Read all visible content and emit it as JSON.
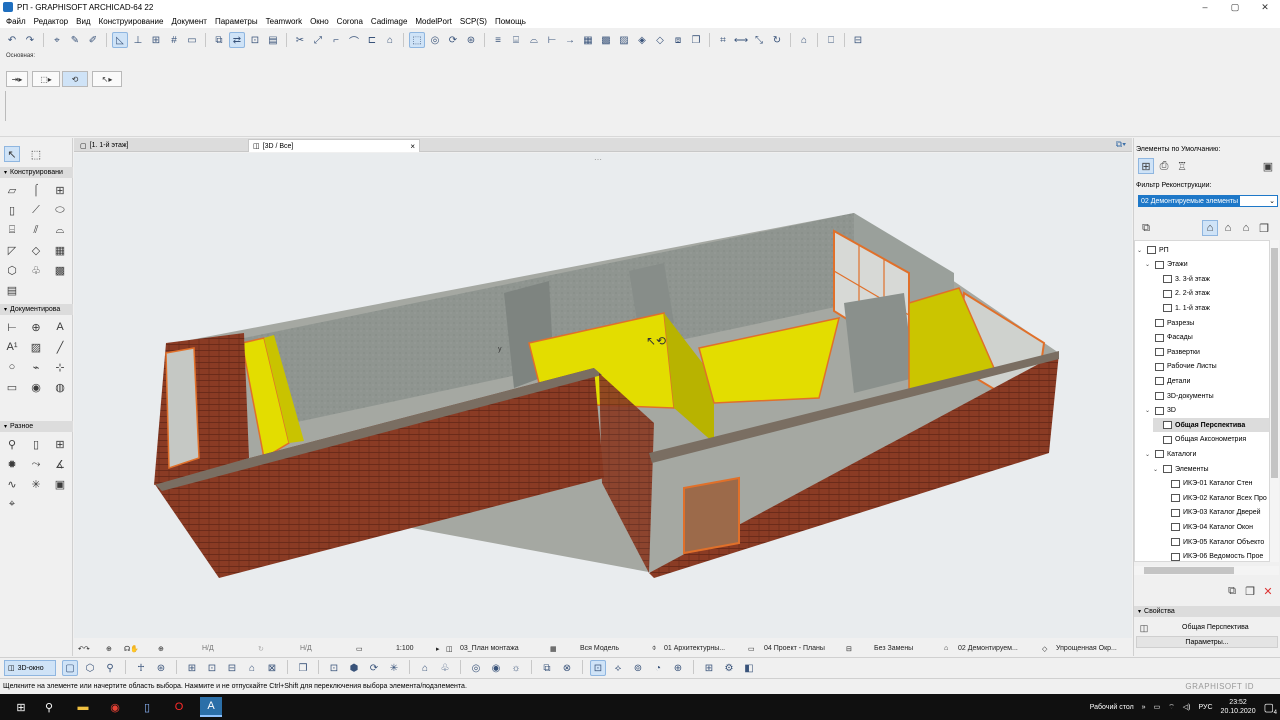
{
  "window": {
    "title": "РП - GRAPHISOFT ARCHICAD-64 22",
    "controls": [
      "‒",
      "▢",
      "✕"
    ]
  },
  "menu": [
    "Файл",
    "Редактор",
    "Вид",
    "Конструирование",
    "Документ",
    "Параметры",
    "Teamwork",
    "Окно",
    "Corona",
    "Cadimage",
    "ModelPort",
    "SCP(S)",
    "Помощь"
  ],
  "infobox": {
    "label": "Основная:"
  },
  "toolbox": {
    "sections": [
      "Конструировани",
      "Документирова",
      "Разное"
    ]
  },
  "tabs": [
    {
      "label": "[1. 1-й этаж]"
    },
    {
      "label": "[3D / Все]",
      "close": "×"
    }
  ],
  "navigator": {
    "header": "Элементы по Умолчанию:",
    "filter_label": "Фильтр Реконструкции:",
    "filter_value": "02 Демонтируемые элементы",
    "tree": [
      {
        "label": "РП",
        "level": 0,
        "toggle": "⌄"
      },
      {
        "label": "Этажи",
        "level": 1,
        "toggle": "⌄"
      },
      {
        "label": "3. 3-й этаж",
        "level": 2,
        "toggle": ""
      },
      {
        "label": "2. 2-й этаж",
        "level": 2,
        "toggle": ""
      },
      {
        "label": "1. 1-й этаж",
        "level": 2,
        "toggle": ""
      },
      {
        "label": "Разрезы",
        "level": 1,
        "toggle": ""
      },
      {
        "label": "Фасады",
        "level": 1,
        "toggle": ""
      },
      {
        "label": "Развертки",
        "level": 1,
        "toggle": ""
      },
      {
        "label": "Рабочие Листы",
        "level": 1,
        "toggle": ""
      },
      {
        "label": "Детали",
        "level": 1,
        "toggle": ""
      },
      {
        "label": "3D-документы",
        "level": 1,
        "toggle": ""
      },
      {
        "label": "3D",
        "level": 1,
        "toggle": "⌄"
      },
      {
        "label": "Общая Перспектива",
        "level": 2,
        "toggle": "",
        "selected": true
      },
      {
        "label": "Общая Аксонометрия",
        "level": 2,
        "toggle": ""
      },
      {
        "label": "Каталоги",
        "level": 1,
        "toggle": "⌄"
      },
      {
        "label": "Элементы",
        "level": 2,
        "toggle": "⌄"
      },
      {
        "label": "ИКЭ-01 Каталог Стен",
        "level": 3,
        "toggle": ""
      },
      {
        "label": "ИКЭ-02 Каталог Всех Про",
        "level": 3,
        "toggle": ""
      },
      {
        "label": "ИКЭ-03 Каталог Дверей",
        "level": 3,
        "toggle": ""
      },
      {
        "label": "ИКЭ-04 Каталог Окон",
        "level": 3,
        "toggle": ""
      },
      {
        "label": "ИКЭ-05 Каталог Объекто",
        "level": 3,
        "toggle": ""
      },
      {
        "label": "ИКЭ-06 Ведомость Прое",
        "level": 3,
        "toggle": ""
      }
    ],
    "properties_header": "Свойства",
    "properties_value": "Общая Перспектива",
    "params_button": "Параметры..."
  },
  "quick_options": {
    "scale1": "Н/Д",
    "scale2": "Н/Д",
    "scale": "1:100",
    "layer_combo": "03_План монтажа",
    "model_view": "Вся Модель",
    "pen_set": "01 Архитектурны...",
    "dimension": "04 Проект - Планы",
    "override": "Без Замены",
    "renovation": "02 Демонтируем...",
    "structure": "Упрощенная Окр..."
  },
  "bottom": {
    "window_button": "3D-окно"
  },
  "status": {
    "message": "Щелкните на элементе или начертите область выбора. Нажмите и не отпускайте Ctrl+Shift для переключения выбора элемента/подэлемента.",
    "brand": "GRAPHISOFT ID"
  },
  "taskbar": {
    "desktop_label": "Рабочий стол",
    "lang": "РУС",
    "time": "23:52",
    "date": "20.10.2020",
    "notification_count": "4"
  },
  "colors": {
    "brick": "#8a3b24",
    "yellow_wall": "#e3dd00",
    "gray_wall": "#8f9590",
    "floor": "#a5a8a2",
    "accent": "#1e78c8"
  }
}
